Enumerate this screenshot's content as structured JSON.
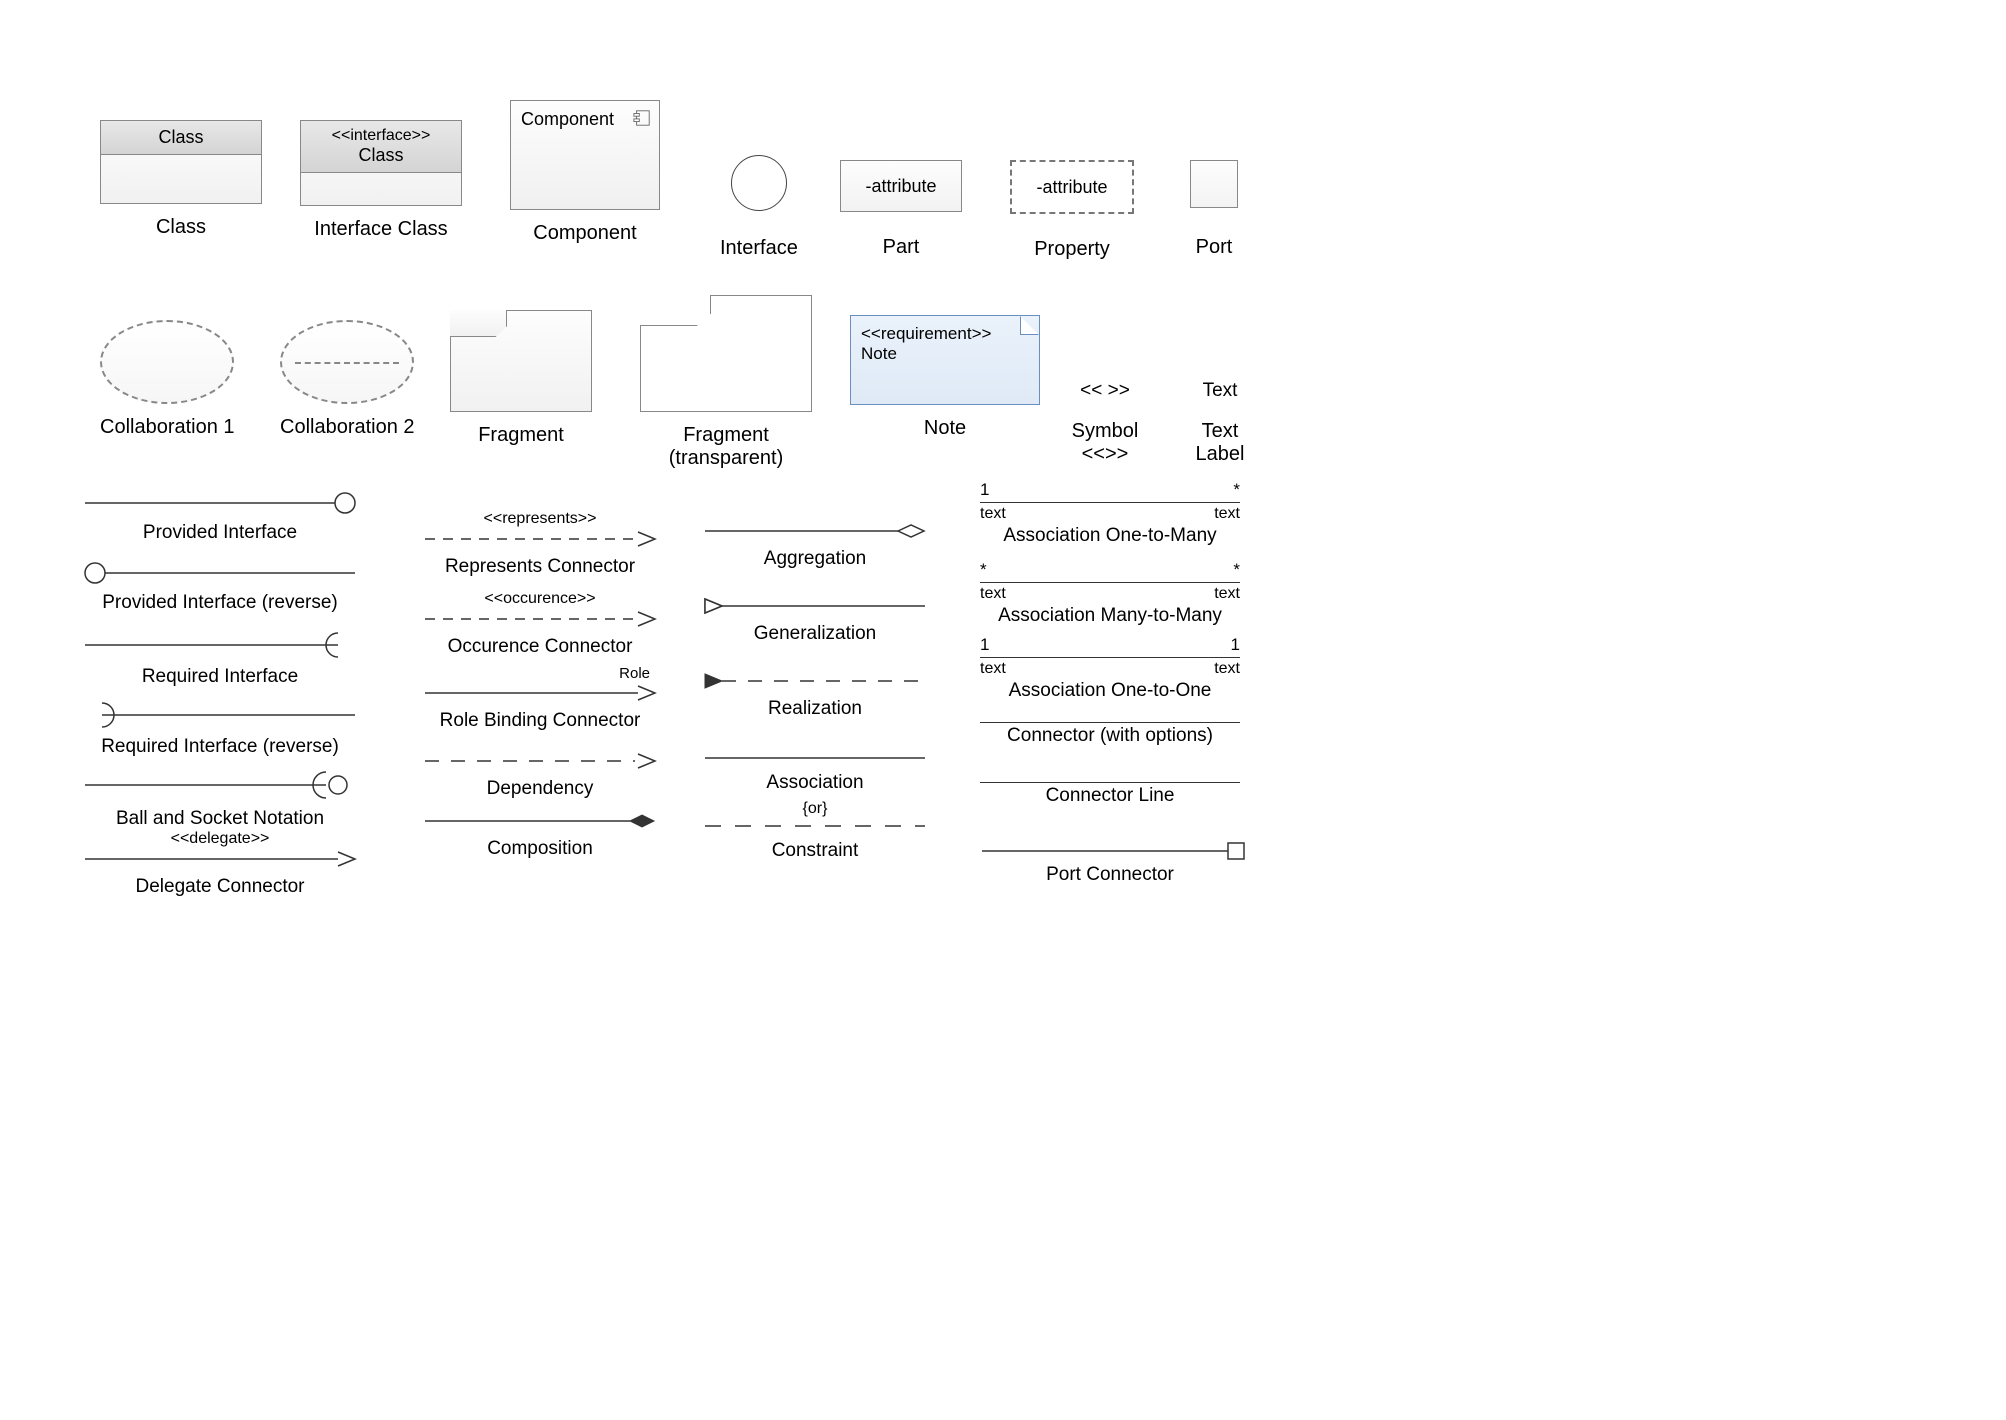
{
  "row1": {
    "class": {
      "title": "Class",
      "caption": "Class"
    },
    "interfaceClass": {
      "stereo": "<<interface>>",
      "title": "Class",
      "caption": "Interface Class"
    },
    "component": {
      "title": "Component",
      "caption": "Component"
    },
    "interface": {
      "caption": "Interface"
    },
    "part": {
      "text": "-attribute",
      "caption": "Part"
    },
    "property": {
      "text": "-attribute",
      "caption": "Property"
    },
    "port": {
      "caption": "Port"
    }
  },
  "row2": {
    "collab1": {
      "caption": "Collaboration 1"
    },
    "collab2": {
      "caption": "Collaboration 2"
    },
    "fragment": {
      "caption": "Fragment"
    },
    "fragmentT": {
      "caption": "Fragment\n(transparent)"
    },
    "note": {
      "stereo": "<<requirement>>",
      "text": "Note",
      "caption": "Note"
    },
    "symbol": {
      "text": "<< >>",
      "caption": "Symbol\n<<>>"
    },
    "textLabel": {
      "text": "Text",
      "caption": "Text\nLabel"
    }
  },
  "col1": {
    "provided": "Provided Interface",
    "providedRev": "Provided Interface (reverse)",
    "required": "Required Interface",
    "requiredRev": "Required Interface (reverse)",
    "ballSocket": "Ball and Socket Notation",
    "delegate": {
      "stereo": "<<delegate>>",
      "caption": "Delegate Connector"
    }
  },
  "col2": {
    "represents": {
      "stereo": "<<represents>>",
      "caption": "Represents Connector"
    },
    "occurence": {
      "stereo": "<<occurence>>",
      "caption": "Occurence Connector"
    },
    "role": {
      "role": "Role",
      "caption": "Role Binding Connector"
    },
    "dependency": "Dependency",
    "composition": "Composition"
  },
  "col3": {
    "aggregation": "Aggregation",
    "generalization": "Generalization",
    "realization": "Realization",
    "association": "Association",
    "constraint": {
      "text": "{or}",
      "caption": "Constraint"
    }
  },
  "col4": {
    "a1": {
      "l": "1",
      "r": "*",
      "tl": "text",
      "tr": "text",
      "caption": "Association One-to-Many"
    },
    "a2": {
      "l": "*",
      "r": "*",
      "tl": "text",
      "tr": "text",
      "caption": "Association Many-to-Many"
    },
    "a3": {
      "l": "1",
      "r": "1",
      "tl": "text",
      "tr": "text",
      "caption": "Association One-to-One"
    },
    "connOpt": "Connector (with options)",
    "connLine": "Connector Line",
    "portConn": "Port Connector"
  }
}
